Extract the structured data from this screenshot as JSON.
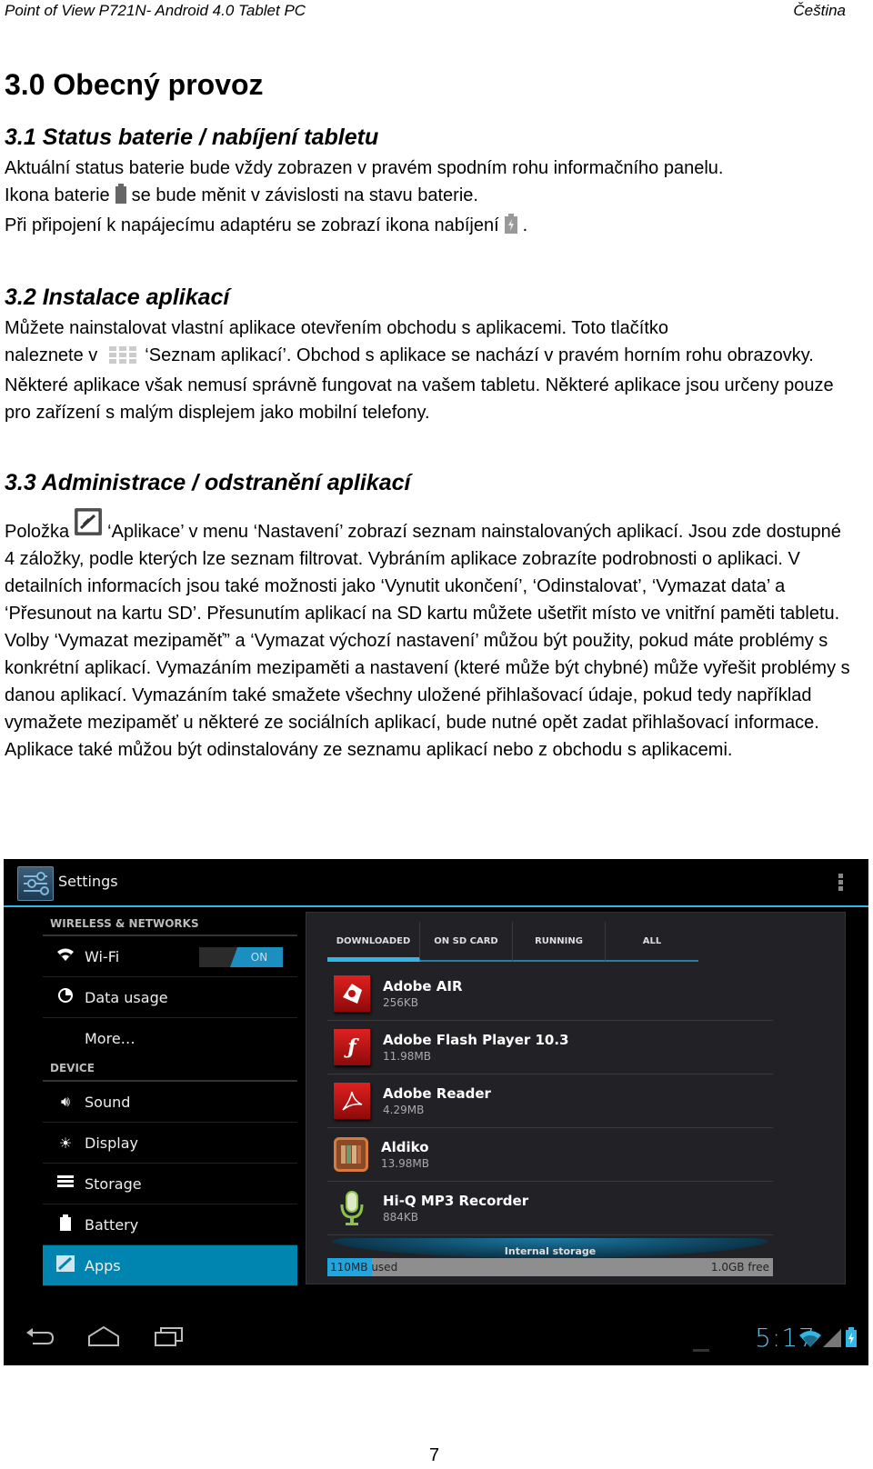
{
  "header": {
    "left": "Point of View P721N- Android 4.0 Tablet PC",
    "right": "Čeština"
  },
  "title": "3.0 Obecný provoz",
  "sections": [
    {
      "heading": "3.1 Status baterie / nabíjení tabletu",
      "lines": [
        "Aktuální status baterie bude vždy zobrazen v pravém spodním rohu informačního panelu.",
        [
          "Ikona baterie",
          "se bude měnit v závislosti na stavu baterie."
        ],
        [
          "Při připojení k napájecímu adaptéru se zobrazí ikona nabíjení",
          "."
        ]
      ]
    },
    {
      "heading": "3.2 Instalace aplikací",
      "p1": "Můžete nainstalovat vlastní aplikace otevřením obchodu s aplikacemi. Toto tlačítko",
      "p2a": "naleznete v",
      "p2b": "‘Seznam aplikací’. Obchod s aplikace se nachází v pravém horním rohu obrazovky. Některé aplikace však nemusí správně fungovat na vašem tabletu. Některé aplikace jsou určeny pouze pro zařízení s malým displejem jako mobilní telefony."
    },
    {
      "heading": "3.3 Administrace / odstranění aplikací",
      "p1a": "Položka",
      "p1b": "‘Aplikace’ v menu ‘Nastavení’ zobrazí seznam nainstalovaných aplikací. Jsou zde dostupné 4 záložky, podle kterých lze seznam filtrovat. Vybráním aplikace zobrazíte podrobnosti o aplikaci. V detailních informacích jsou také možnosti jako ‘Vynutit ukončení’, ‘Odinstalovat’, ‘Vymazat data’ a ‘Přesunout na kartu SD’. Přesunutím aplikací na SD kartu můžete ušetřit místo ve vnitřní paměti tabletu.",
      "p2": "Volby ‘Vymazat mezipaměť” a ‘Vymazat výchozí nastavení’ můžou být použity, pokud máte problémy s konkrétní aplikací. Vymazáním mezipaměti a nastavení (které může být chybné) může vyřešit problémy s danou aplikací. Vymazáním také smažete všechny uložené přihlašovací údaje, pokud tedy například vymažete mezipaměť u některé ze sociálních aplikací, bude nutné opět zadat přihlašovací informace.",
      "p3": "Aplikace také můžou být odinstalovány ze seznamu aplikací nebo z obchodu s aplikacemi."
    }
  ],
  "tablet": {
    "app_title": "Settings",
    "accent": "#33b5e5",
    "sidebar": {
      "section1": "WIRELESS & NETWORKS",
      "section2": "DEVICE",
      "wifi": {
        "label": "Wi-Fi",
        "toggle": "ON",
        "icon": "wifi-icon"
      },
      "items": [
        {
          "label": "Data usage",
          "icon": "data-usage-icon"
        },
        {
          "label": "More…",
          "icon": ""
        },
        {
          "label": "Sound",
          "icon": "speaker-icon"
        },
        {
          "label": "Display",
          "icon": "brightness-icon"
        },
        {
          "label": "Storage",
          "icon": "storage-icon"
        },
        {
          "label": "Battery",
          "icon": "battery-icon"
        },
        {
          "label": "Apps",
          "icon": "apps-icon",
          "selected": true
        }
      ]
    },
    "tabs": [
      "DOWNLOADED",
      "ON SD CARD",
      "RUNNING",
      "ALL"
    ],
    "selected_tab": "DOWNLOADED",
    "apps": [
      {
        "name": "Adobe AIR",
        "size": "256KB",
        "icon": "adobe-air-icon"
      },
      {
        "name": "Adobe Flash Player 10.3",
        "size": "11.98MB",
        "icon": "flash-icon"
      },
      {
        "name": "Adobe Reader",
        "size": "4.29MB",
        "icon": "adobe-reader-icon"
      },
      {
        "name": "Aldiko",
        "size": "13.98MB",
        "icon": "aldiko-icon"
      },
      {
        "name": "Hi-Q MP3 Recorder",
        "size": "884KB",
        "icon": "microphone-icon"
      }
    ],
    "storage": {
      "label": "Internal storage",
      "used": "110MB",
      "used_suffix": "used",
      "free": "1.0GB free",
      "used_fraction": 0.1
    },
    "statusbar": {
      "time": "5:17"
    }
  },
  "page_number": "7"
}
